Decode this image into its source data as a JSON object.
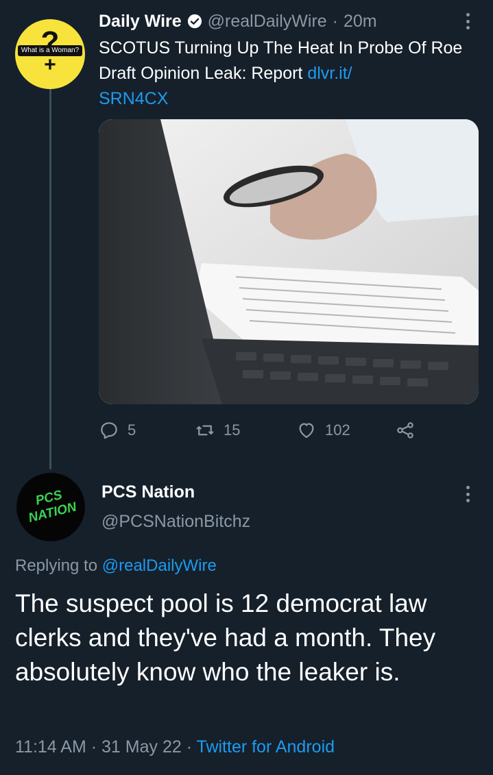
{
  "tweet1": {
    "avatar_text": "What is a Woman?",
    "avatar_symbol_top": "?",
    "avatar_symbol_bottom": "+",
    "author_name": "Daily Wire",
    "handle": "@realDailyWire",
    "separator": "·",
    "time": "20m",
    "text_plain": "SCOTUS Turning Up The Heat In Probe Of Roe Draft Opinion Leak: Report ",
    "link_part1": "dlvr.it/",
    "link_part2": "SRN4CX",
    "media_description_icon": "magnifying-glass-over-document-photo",
    "replies": "5",
    "retweets": "15",
    "likes": "102"
  },
  "tweet2": {
    "avatar_logo": "PCS NATION",
    "author_name": "PCS Nation",
    "handle": "@PCSNationBitchz",
    "replying_prefix": "Replying to",
    "replying_handle": "@realDailyWire",
    "text": "The suspect pool is 12 democrat law clerks and they've had a month. They absolutely know who the leaker is.",
    "time": "11:14 AM",
    "date": "31 May 22",
    "separator": "·",
    "source": "Twitter for Android"
  },
  "colors": {
    "background": "#15202b",
    "text": "#ffffff",
    "muted": "#8b98a5",
    "link": "#1d9bf0",
    "avatar_yellow": "#f7e33b",
    "pcs_green": "#39d353"
  }
}
